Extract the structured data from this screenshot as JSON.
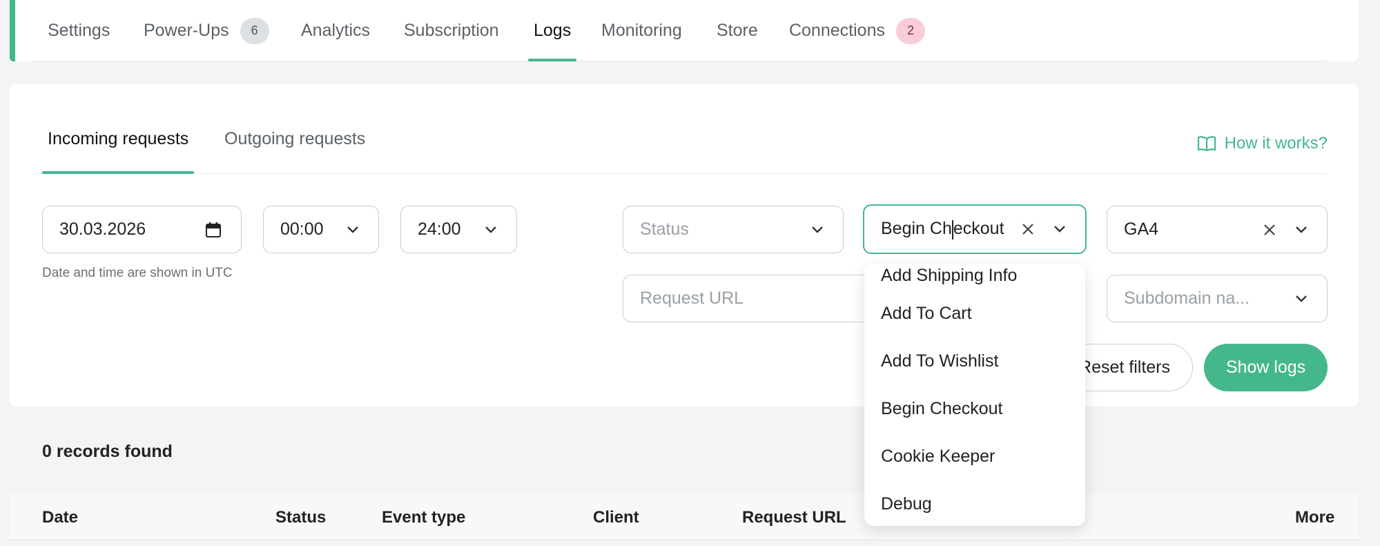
{
  "nav": {
    "tabs": [
      {
        "label": "Settings"
      },
      {
        "label": "Power-Ups",
        "badge": "6"
      },
      {
        "label": "Analytics"
      },
      {
        "label": "Subscription"
      },
      {
        "label": "Logs",
        "active": true
      },
      {
        "label": "Monitoring"
      },
      {
        "label": "Store"
      },
      {
        "label": "Connections",
        "badge": "2"
      }
    ]
  },
  "subtabs": [
    {
      "label": "Incoming requests",
      "active": true
    },
    {
      "label": "Outgoing requests"
    }
  ],
  "help_link": {
    "label": "How it works?",
    "icon": "book-open-icon"
  },
  "filters": {
    "date": "30.03.2026",
    "time_from": "00:00",
    "time_to": "24:00",
    "timezone_hint": "Date and time are shown in UTC",
    "status_placeholder": "Status",
    "event_type_value_before_caret": "Begin Ch",
    "event_type_value_after_caret": "eckout",
    "client_value": "GA4",
    "request_url_placeholder": "Request URL",
    "subdomain_placeholder": "Subdomain na..."
  },
  "buttons": {
    "reset": "Reset filters",
    "show": "Show logs"
  },
  "dropdown_options": [
    "Add Shipping Info",
    "Add To Cart",
    "Add To Wishlist",
    "Begin Checkout",
    "Cookie Keeper",
    "Debug"
  ],
  "results": {
    "count_text": "0 records found"
  },
  "table": {
    "headers": [
      "Date",
      "Status",
      "Event type",
      "Client",
      "Request URL",
      "More"
    ]
  },
  "colors": {
    "accent": "#44b78b",
    "pink_badge": "#f9cdd7"
  }
}
